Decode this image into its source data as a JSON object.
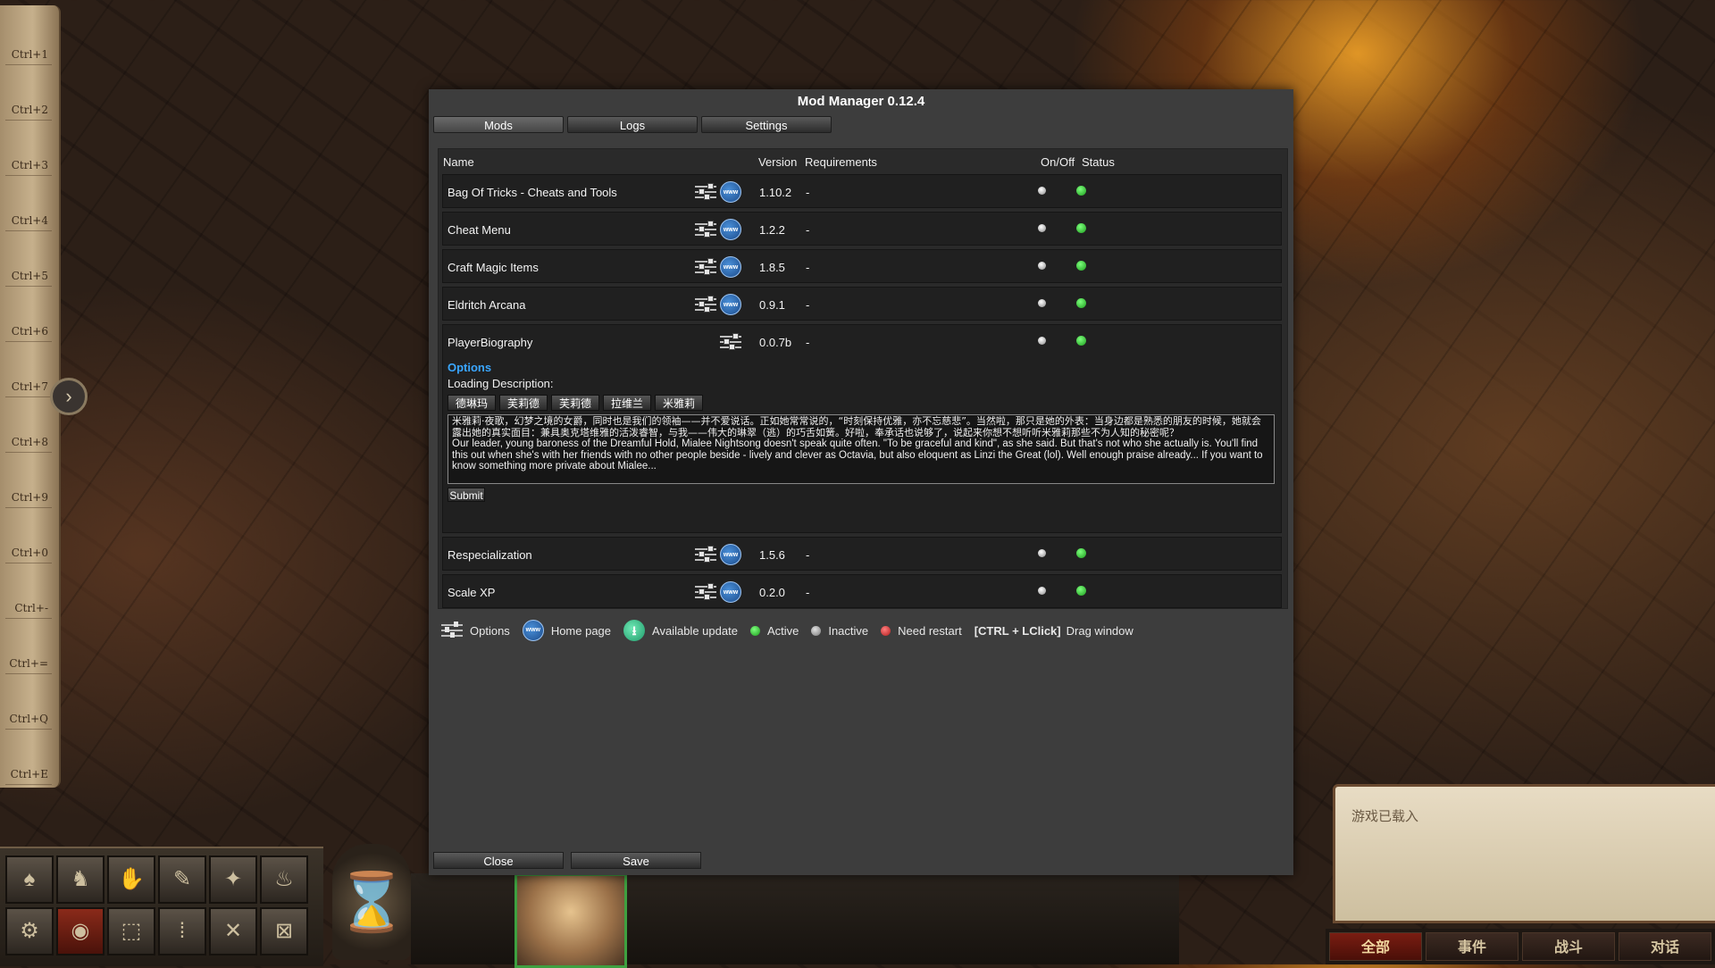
{
  "window": {
    "title": "Mod Manager 0.12.4",
    "tabs": [
      "Mods",
      "Logs",
      "Settings"
    ],
    "active_tab": "Mods",
    "footer": {
      "close_label": "Close",
      "save_label": "Save"
    }
  },
  "table": {
    "headers": {
      "name": "Name",
      "version": "Version",
      "requirements": "Requirements",
      "onoff": "On/Off",
      "status": "Status"
    },
    "mods": [
      {
        "name": "Bag Of Tricks - Cheats and Tools",
        "version": "1.10.2",
        "requirements": "-",
        "has_homepage": true,
        "status": "active"
      },
      {
        "name": "Cheat Menu",
        "version": "1.2.2",
        "requirements": "-",
        "has_homepage": true,
        "status": "active"
      },
      {
        "name": "Craft Magic Items",
        "version": "1.8.5",
        "requirements": "-",
        "has_homepage": true,
        "status": "active"
      },
      {
        "name": "Eldritch Arcana",
        "version": "0.9.1",
        "requirements": "-",
        "has_homepage": true,
        "status": "active"
      },
      {
        "name": "PlayerBiography",
        "version": "0.0.7b",
        "requirements": "-",
        "has_homepage": false,
        "status": "active",
        "expanded": true
      },
      {
        "name": "Respecialization",
        "version": "1.5.6",
        "requirements": "-",
        "has_homepage": true,
        "status": "active"
      },
      {
        "name": "Scale XP",
        "version": "0.2.0",
        "requirements": "-",
        "has_homepage": true,
        "status": "active"
      }
    ],
    "expanded_options": {
      "heading": "Options",
      "loading_label": "Loading Description:",
      "name_buttons": [
        "德琳玛",
        "芙莉德",
        "芙莉德",
        "拉维兰",
        "米雅莉"
      ],
      "description_zh": "米雅莉·夜歌，幻梦之境的女爵，同时也是我们的领袖——并不爱说话。正如她常常说的，“时刻保持优雅，亦不忘慈悲”。当然啦，那只是她的外表：当身边都是熟悉的朋友的时候，她就会露出她的真实面目：兼具奥克塔维雅的活泼睿智，与我——伟大的琳翠（逃）的巧舌如簧。好啦，奉承话也说够了，说起来你想不想听听米雅莉那些不为人知的秘密呢？",
      "description_en": "Our leader, young baroness of the Dreamful Hold, Mialee Nightsong doesn't speak quite often. \"To be graceful and kind\", as she said. But that's not who she actually is. You'll find this out when she's with her friends with no other people beside - lively and clever as Octavia, but also eloquent as Linzi the Great (lol). Well enough praise already... If you want to know something more private about Mialee...",
      "submit_label": "Submit"
    }
  },
  "legend": {
    "options": "Options",
    "homepage": "Home page",
    "update": "Available update",
    "active": "Active",
    "inactive": "Inactive",
    "restart": "Need restart",
    "shortcut": "[CTRL + LClick]",
    "drag": "Drag window",
    "www_glyph": "www",
    "update_glyph": "⭳"
  },
  "hotbar": {
    "keys": [
      "Ctrl+1",
      "Ctrl+2",
      "Ctrl+3",
      "Ctrl+4",
      "Ctrl+5",
      "Ctrl+6",
      "Ctrl+7",
      "Ctrl+8",
      "Ctrl+9",
      "Ctrl+0",
      "Ctrl+-",
      "Ctrl+=",
      "Ctrl+Q",
      "Ctrl+E"
    ],
    "arrow_glyph": "›"
  },
  "actions": {
    "glyphs": [
      "♠",
      "♞",
      "✋",
      "✎",
      "✦",
      "♨",
      "⚙",
      "◉",
      "⬚",
      "⁞",
      "✕",
      "⊠"
    ]
  },
  "hourglass_glyph": "⌛",
  "log": {
    "text": "游戏已载入",
    "tabs": [
      "全部",
      "事件",
      "战斗",
      "对话"
    ],
    "active_tab": "全部"
  },
  "colors": {
    "status_active": "#1c9c1c",
    "link": "#3aa6ff",
    "window_bg": "#3d3d3d"
  }
}
